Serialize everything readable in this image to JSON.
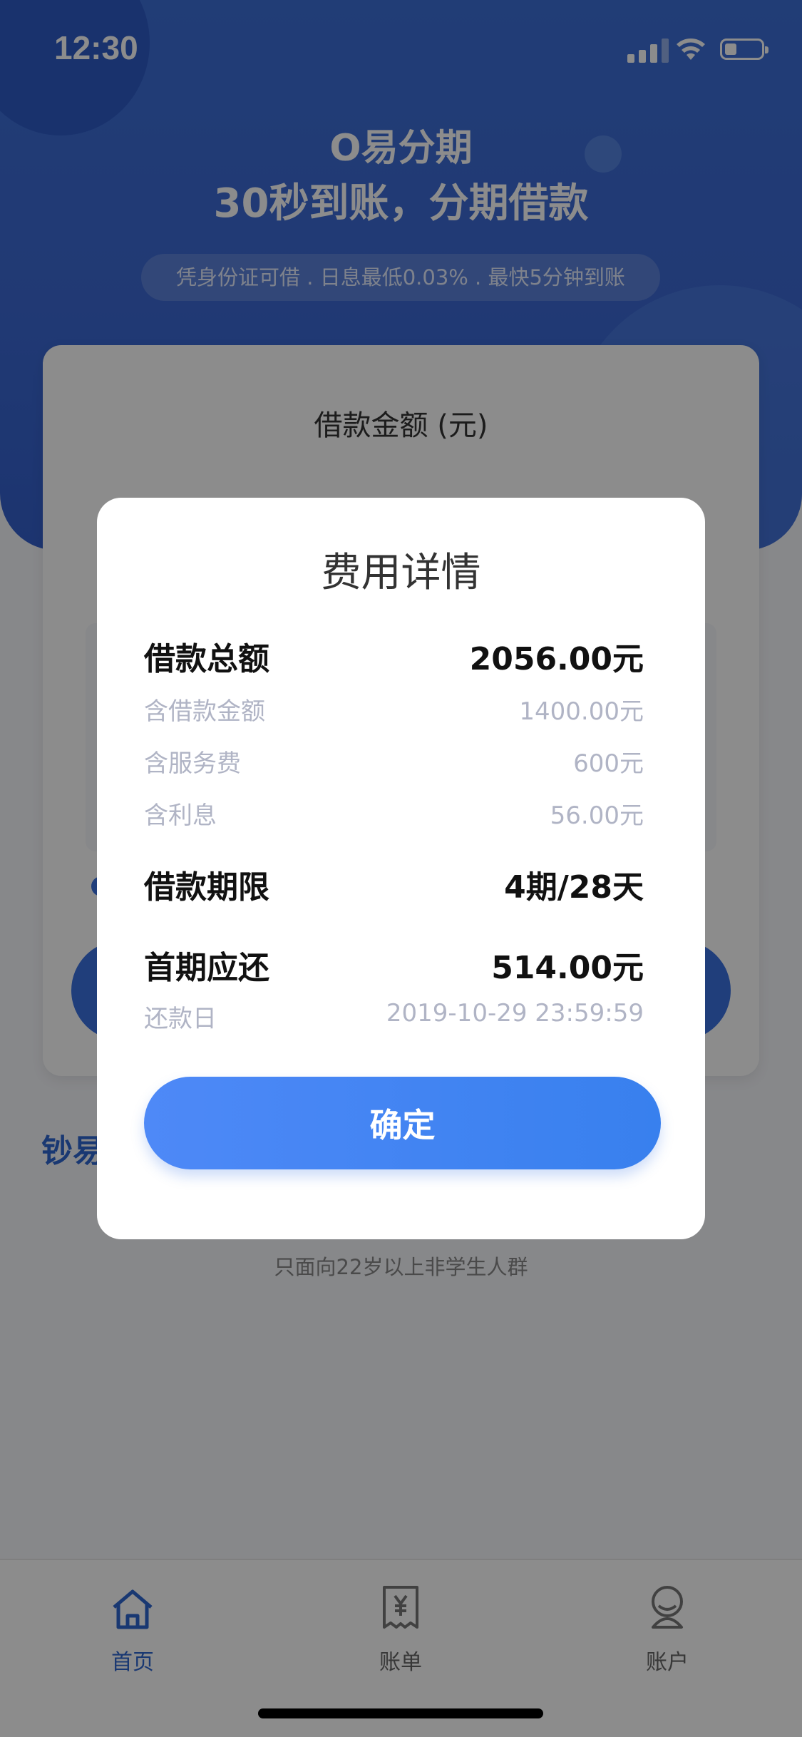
{
  "status_bar": {
    "time": "12:30"
  },
  "hero": {
    "title": "O易分期",
    "subtitle": "30秒到账，分期借款",
    "tagline": "凭身份证可借 . 日息最低0.03% . 最快5分钟到账"
  },
  "loan_card": {
    "amount_title": "借款金额 (元)"
  },
  "brand": "钞易",
  "note": "只面向22岁以上非学生人群",
  "modal": {
    "title": "费用详情",
    "total_label": "借款总额",
    "total_value": "2056.00元",
    "principal_label": "含借款金额",
    "principal_value": "1400.00元",
    "service_label": "含服务费",
    "service_value": "600元",
    "interest_label": "含利息",
    "interest_value": "56.00元",
    "term_label": "借款期限",
    "term_value": "4期/28天",
    "first_label": "首期应还",
    "first_value": "514.00元",
    "due_label": "还款日",
    "due_value": "2019-10-29 23:59:59",
    "confirm_label": "确定"
  },
  "tabbar": {
    "tabs": [
      {
        "label": "首页",
        "icon": "home-icon",
        "active": true
      },
      {
        "label": "账单",
        "icon": "bill-icon",
        "active": false
      },
      {
        "label": "账户",
        "icon": "account-icon",
        "active": false
      }
    ]
  },
  "colors": {
    "accent": "#3b72e0",
    "hero": "#3d6fd8"
  }
}
